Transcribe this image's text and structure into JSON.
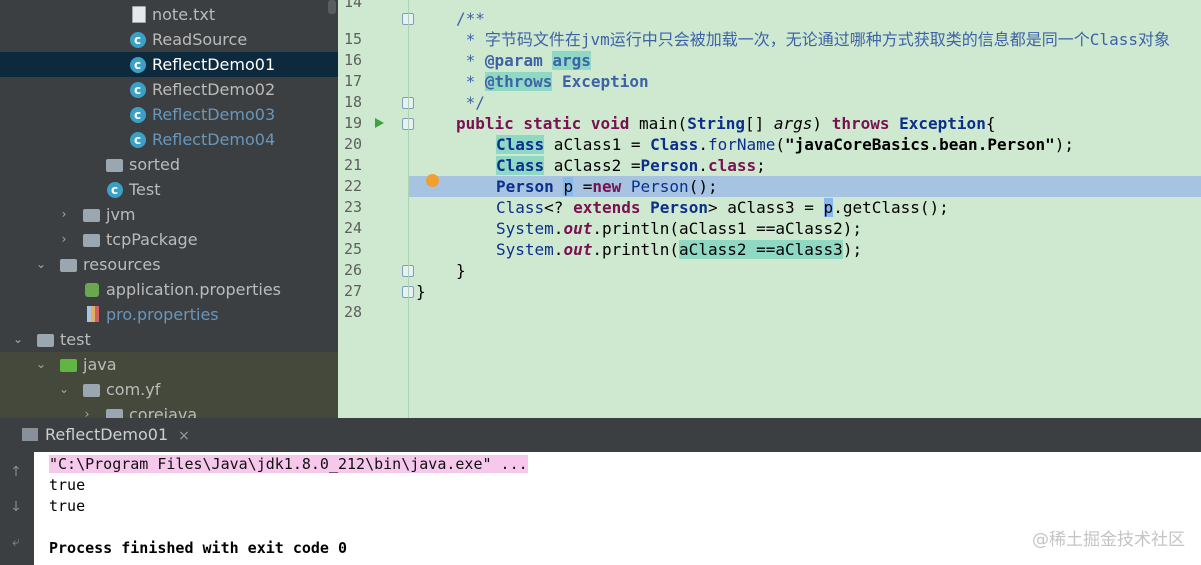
{
  "project_tree": {
    "items": [
      {
        "label": "note.txt",
        "type": "file"
      },
      {
        "label": "ReadSource",
        "type": "class"
      },
      {
        "label": "ReflectDemo01",
        "type": "class",
        "selected": true
      },
      {
        "label": "ReflectDemo02",
        "type": "class"
      },
      {
        "label": "ReflectDemo03",
        "type": "class"
      },
      {
        "label": "ReflectDemo04",
        "type": "class"
      },
      {
        "label": "sorted",
        "type": "folder"
      },
      {
        "label": "Test",
        "type": "class"
      },
      {
        "label": "jvm",
        "type": "package"
      },
      {
        "label": "tcpPackage",
        "type": "package"
      },
      {
        "label": "resources",
        "type": "folder"
      },
      {
        "label": "application.properties",
        "type": "properties"
      },
      {
        "label": "pro.properties",
        "type": "properties"
      },
      {
        "label": "test",
        "type": "folder"
      },
      {
        "label": "java",
        "type": "folder"
      },
      {
        "label": "com.yf",
        "type": "package"
      },
      {
        "label": "corejava",
        "type": "package"
      }
    ]
  },
  "editor": {
    "line_numbers": [
      "14",
      "15",
      "16",
      "17",
      "18",
      "19",
      "20",
      "21",
      "22",
      "23",
      "24",
      "25",
      "26",
      "27",
      "28"
    ],
    "lines": {
      "l14": "/**",
      "l15": " * 字节码文件在jvm运行中只会被加载一次，无论通过哪种方式获取类的信息都是同一个Class对象",
      "l16a": " * ",
      "l16b": "@param",
      "l16c": " ",
      "l16d": "args",
      "l17a": " * ",
      "l17b": "@throws",
      "l17c": " ",
      "l17d": "Exception",
      "l18": " */",
      "l19a": "public static void",
      "l19b": " main(",
      "l19c": "String",
      "l19d": "[] ",
      "l19e": "args",
      "l19f": ") ",
      "l19g": "throws",
      "l19h": " ",
      "l19i": "Exception",
      "l19j": "{",
      "l20a": "Class",
      "l20b": " aClass1 = ",
      "l20c": "Class",
      "l20d": ".",
      "l20e": "forName",
      "l20f": "(",
      "l20g": "\"javaCoreBasics.bean.Person\"",
      "l20h": ");",
      "l21a": "Class",
      "l21b": " aClass2 =",
      "l21c": "Person",
      "l21d": ".",
      "l21e": "class",
      "l21f": ";",
      "l22a": "Person",
      "l22b": " ",
      "l22c": "p",
      "l22d": " =",
      "l22e": "new",
      "l22f": " ",
      "l22g": "Person",
      "l22h": "();",
      "l23a": "Class",
      "l23b": "<? ",
      "l23c": "extends",
      "l23d": " ",
      "l23e": "Person",
      "l23f": "> aClass3 = ",
      "l23g": "p",
      "l23h": ".getClass();",
      "l24a": "System",
      "l24b": ".",
      "l24c": "out",
      "l24d": ".println(aClass1 ==aClass2);",
      "l25a": "System",
      "l25b": ".",
      "l25c": "out",
      "l25d": ".println(",
      "l25e": "aClass2 ==aClass3",
      "l25f": ");",
      "l26": "}",
      "l27": "}",
      "l28": ""
    }
  },
  "run_panel": {
    "tab_label": "ReflectDemo01",
    "close_glyph": "×",
    "console": [
      "\"C:\\Program Files\\Java\\jdk1.8.0_212\\bin\\java.exe\" ...",
      "true",
      "true",
      "",
      "Process finished with exit code 0"
    ]
  },
  "watermark": "@稀土掘金技术社区",
  "colors": {
    "editor_bg": "#cfe9d0",
    "current_line": "#a6c4e1",
    "sidebar_bg": "#3c3f41",
    "selected_row": "#0d293e"
  }
}
